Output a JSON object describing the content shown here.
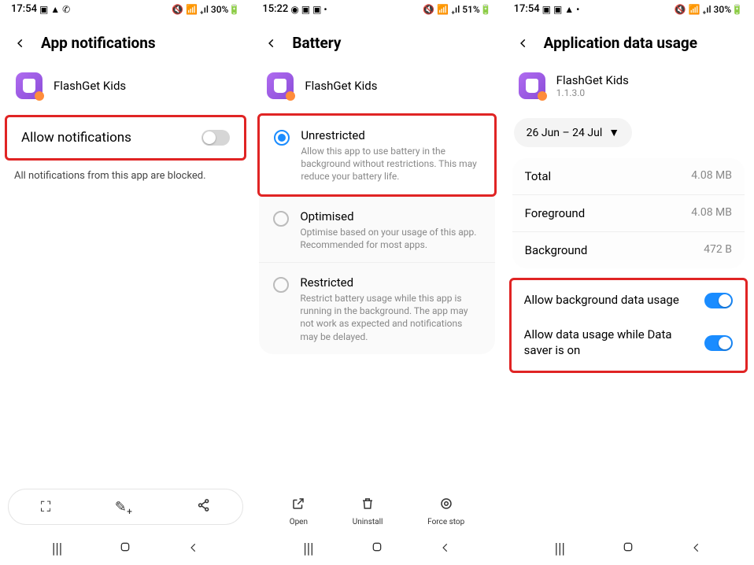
{
  "screen1": {
    "status": {
      "time": "17:54",
      "left_icons": "▣ ▲ ✆",
      "right_icons": "🔇 📶 ₊ıl 30%🔋"
    },
    "title": "App notifications",
    "app_name": "FlashGet Kids",
    "toggle_label": "Allow notifications",
    "info": "All notifications from this app are blocked."
  },
  "screen2": {
    "status": {
      "time": "15:22",
      "left_icons": "◉ ▣ ▣ •",
      "right_icons": "🔇 📶 ₊ıl 51%🔋"
    },
    "title": "Battery",
    "app_name": "FlashGet Kids",
    "options": [
      {
        "title": "Unrestricted",
        "desc": "Allow this app to use battery in the background without restrictions. This may reduce your battery life.",
        "selected": true
      },
      {
        "title": "Optimised",
        "desc": "Optimise based on your usage of this app. Recommended for most apps.",
        "selected": false
      },
      {
        "title": "Restricted",
        "desc": "Restrict battery usage while this app is running in the background. The app may not work as expected and notifications may be delayed.",
        "selected": false
      }
    ],
    "actions": {
      "open": "Open",
      "uninstall": "Uninstall",
      "forcestop": "Force stop"
    }
  },
  "screen3": {
    "status": {
      "time": "17:54",
      "left_icons": "▣ ▣ ▲ •",
      "right_icons": "🔇 📶 ₊ıl 30%🔋"
    },
    "title": "Application data usage",
    "app_name": "FlashGet Kids",
    "app_version": "1.1.3.0",
    "date_range": "26 Jun – 24 Jul",
    "rows": [
      {
        "label": "Total",
        "value": "4.08 MB"
      },
      {
        "label": "Foreground",
        "value": "4.08 MB"
      },
      {
        "label": "Background",
        "value": "472 B"
      }
    ],
    "toggles": [
      {
        "label": "Allow background data usage",
        "on": true
      },
      {
        "label": "Allow data usage while Data saver is on",
        "on": true
      }
    ]
  }
}
